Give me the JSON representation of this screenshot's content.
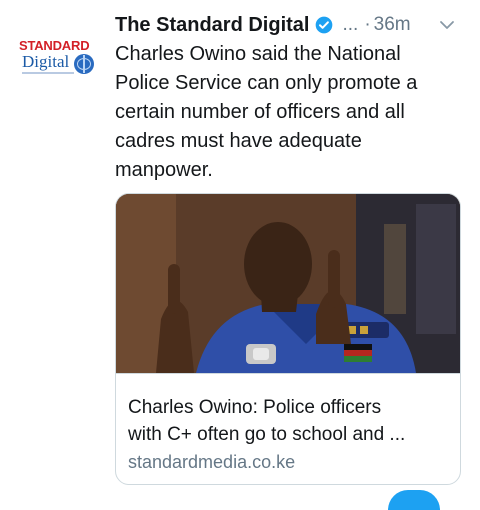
{
  "tweet": {
    "author": "The Standard Digital",
    "handle": "...",
    "separator": "·",
    "time": "36m",
    "text_lines": [
      "Charles Owino said the National",
      "Police Service can only promote a",
      "certain number of officers and all",
      "cadres must have adequate",
      "manpower."
    ]
  },
  "logo": {
    "top": "STANDARD",
    "bottom": "Digital"
  },
  "card": {
    "title_lines": [
      "Charles Owino: Police officers",
      "with C+ often go to school and ..."
    ],
    "domain": "standardmedia.co.ke"
  },
  "colors": {
    "verified": "#1da1f2",
    "brand_red": "#d32027",
    "brand_blue": "#1b5aa6"
  },
  "icons": [
    "verified-badge-icon",
    "chevron-down-icon"
  ]
}
